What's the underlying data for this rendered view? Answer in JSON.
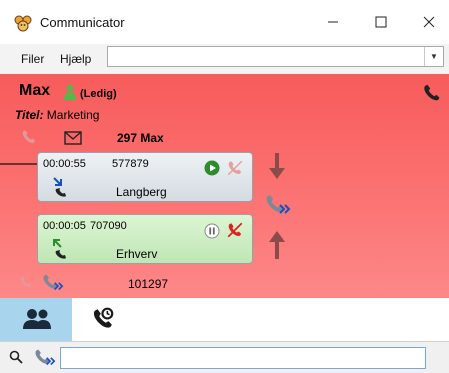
{
  "window": {
    "title": "Communicator"
  },
  "menu": {
    "file": "Filer",
    "help": "Hjælp",
    "combo_value": ""
  },
  "agent": {
    "name": "Max",
    "status": "(Ledig)",
    "title_label": "Titel:",
    "title_value": "Marketing",
    "mailbox_count": "297 Max"
  },
  "calls": [
    {
      "duration": "00:00:55",
      "number": "577879",
      "name": "Langberg",
      "state": "on-hold",
      "direction": "incoming"
    },
    {
      "duration": "00:00:05",
      "number": "707090",
      "name": "Erhverv",
      "state": "active",
      "direction": "outgoing"
    }
  ],
  "forward": {
    "number": "101297"
  },
  "search": {
    "value": "",
    "placeholder": ""
  },
  "colors": {
    "panel_top": "#f75b5b",
    "panel_bottom": "#fd8888",
    "accent_blue": "#1a4fbf",
    "green": "#2e8b2e",
    "hangup_red": "#e02020",
    "tab_active": "#a8d4ee"
  }
}
